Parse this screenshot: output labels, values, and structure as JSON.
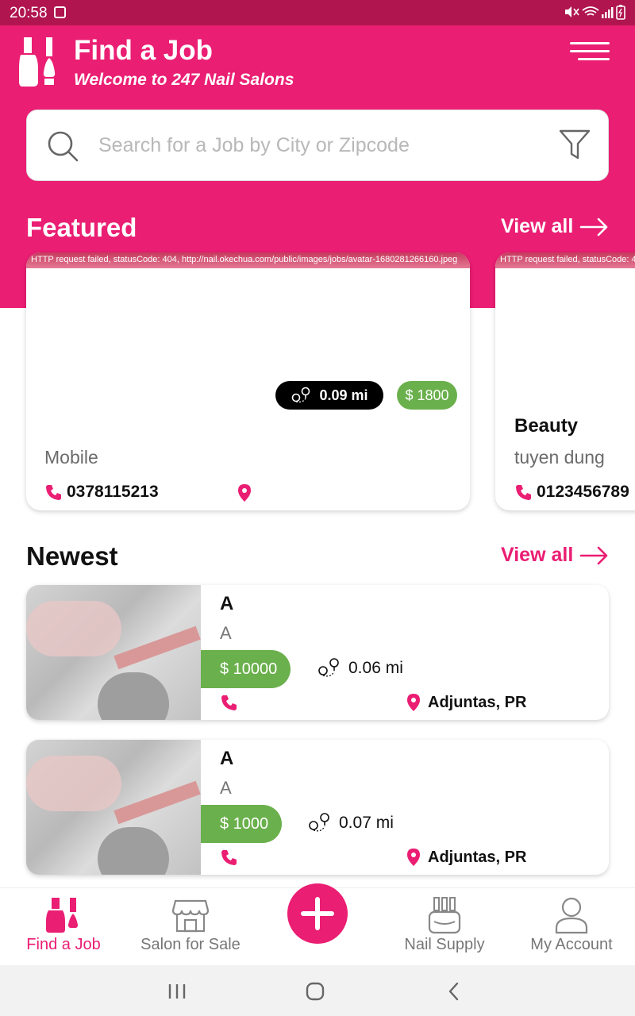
{
  "status_bar": {
    "time": "20:58",
    "system_icons": "mute wifi signal battery"
  },
  "header": {
    "title": "Find a Job",
    "subtitle": "Welcome to 247 Nail Salons",
    "menu_icon": "hamburger-menu-icon"
  },
  "search": {
    "placeholder": "Search for a Job by City or Zipcode",
    "value": ""
  },
  "featured": {
    "title": "Featured",
    "view_all": "View all",
    "cards": [
      {
        "error_text": "HTTP request failed, statusCode: 404, http://nail.okechua.com/public/images/jobs/avatar-1680281266160.jpeg",
        "distance": "0.09 mi",
        "price": "$ 1800",
        "name": "",
        "subtitle": "Mobile",
        "phone": "0378115213"
      },
      {
        "error_text": "HTTP request failed, statusCode: 4",
        "name": "Beauty",
        "subtitle": "tuyen dung",
        "phone": "0123456789"
      }
    ]
  },
  "newest": {
    "title": "Newest",
    "view_all": "View all",
    "items": [
      {
        "title": "A",
        "subtitle": "A",
        "price": "$ 10000",
        "distance": "0.06 mi",
        "location": "Adjuntas, PR"
      },
      {
        "title": "A",
        "subtitle": "A",
        "price": "$ 1000",
        "distance": "0.07 mi",
        "location": "Adjuntas, PR"
      }
    ]
  },
  "bottom_nav": {
    "items": [
      {
        "label": "Find a Job",
        "active": true
      },
      {
        "label": "Salon for Sale",
        "active": false
      },
      {
        "label": "Nail Supply",
        "active": false
      },
      {
        "label": "My Account",
        "active": false
      }
    ]
  },
  "colors": {
    "brand": "#ea1e73",
    "status_bar": "#b0154f",
    "price_green": "#6ab04c",
    "inactive": "#777777"
  }
}
